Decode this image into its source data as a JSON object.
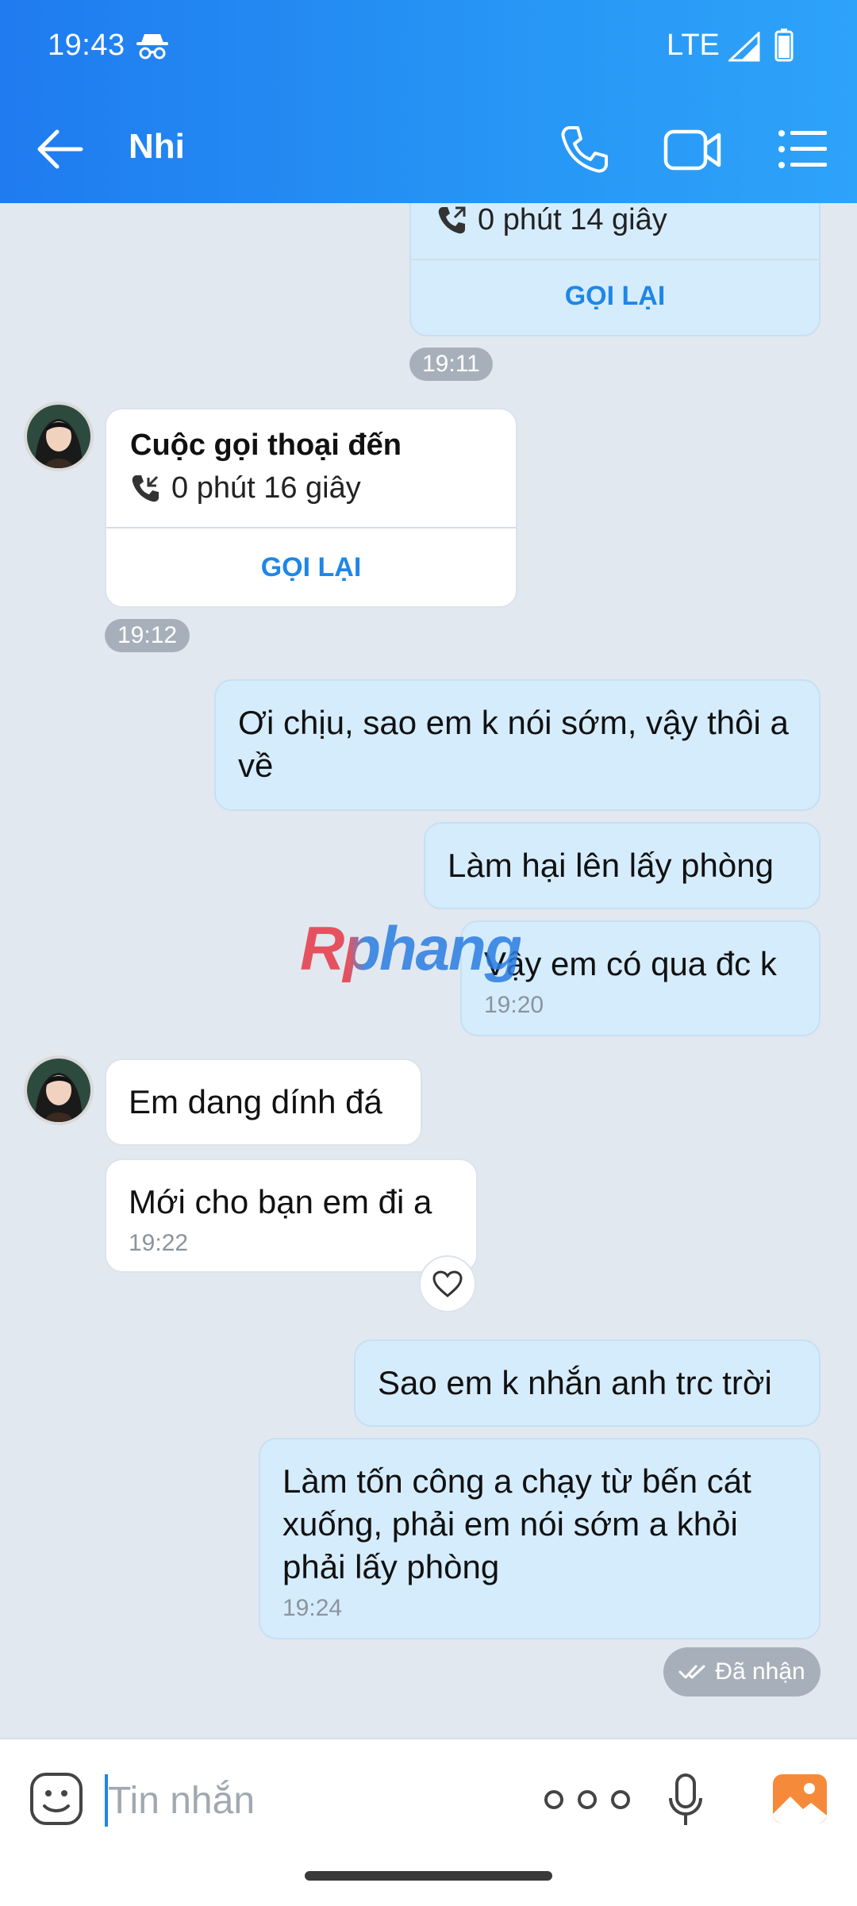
{
  "status_bar": {
    "time": "19:43",
    "network": "LTE"
  },
  "header": {
    "contact_name": "Nhi"
  },
  "messages": {
    "call_out": {
      "duration": "0 phút 14 giây",
      "callback": "GỌI LẠI",
      "time": "19:11"
    },
    "call_in": {
      "title": "Cuộc gọi thoại đến",
      "duration": "0 phút 16 giây",
      "callback": "GỌI LẠI",
      "time": "19:12"
    },
    "m1": {
      "text": "Ơi chịu, sao em k nói sớm, vậy thôi a về"
    },
    "m2": {
      "text": "Làm hại lên lấy phòng"
    },
    "m3": {
      "text": "Vậy em có qua đc k",
      "time": "19:20"
    },
    "m4": {
      "text": "Em dang dính đá"
    },
    "m5": {
      "text": "Mới cho bạn em đi a",
      "time": "19:22"
    },
    "m6": {
      "text": "Sao em k nhắn anh trc trời"
    },
    "m7": {
      "text": "Làm tốn công a chạy từ bến cát xuống, phải em nói sớm a khỏi phải lấy phòng",
      "time": "19:24"
    },
    "receipt": "Đã nhận"
  },
  "watermark": "Rphang",
  "composer": {
    "placeholder": "Tin nhắn"
  },
  "colors": {
    "header_start": "#1f7bef",
    "header_end": "#2ea3fa",
    "my_bubble": "#d5ecfd",
    "accent": "#1f86e8"
  }
}
